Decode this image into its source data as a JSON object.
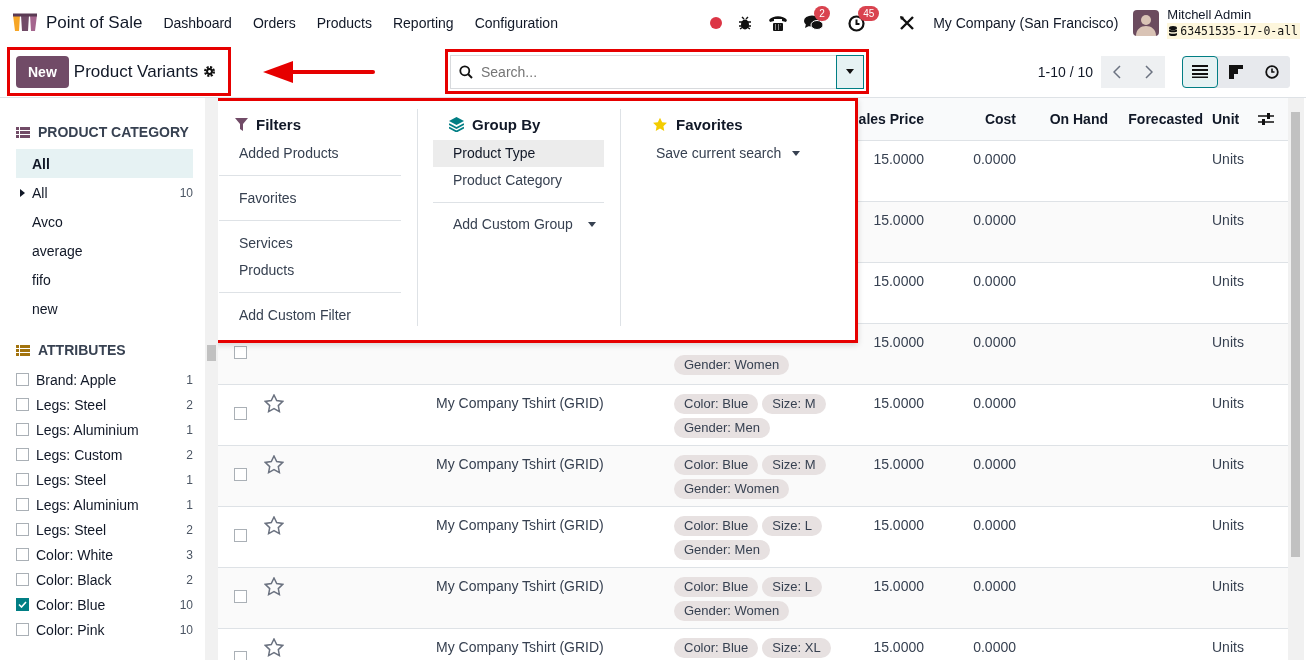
{
  "app": {
    "name": "Point of Sale",
    "menu": [
      "Dashboard",
      "Orders",
      "Products",
      "Reporting",
      "Configuration"
    ]
  },
  "systray": {
    "chat_badge": "2",
    "activity_badge": "45",
    "company": "My Company (San Francisco)",
    "user": "Mitchell Admin",
    "database": "63451535-17-0-all"
  },
  "control_panel": {
    "new_button": "New",
    "title": "Product Variants",
    "search": {
      "placeholder": "Search..."
    },
    "pager": "1-10 / 10",
    "views": [
      {
        "kind": "list",
        "selected": true
      },
      {
        "kind": "kanban",
        "selected": false
      },
      {
        "kind": "activity",
        "selected": false
      }
    ]
  },
  "search_panel": {
    "sections": [
      {
        "kind": "category",
        "title": "PRODUCT CATEGORY",
        "items": [
          {
            "label": "All",
            "selected": true,
            "has_children": false
          },
          {
            "label": "All",
            "selected": false,
            "has_children": true,
            "count": "10"
          },
          {
            "label": "Avco",
            "selected": false,
            "has_children": false
          },
          {
            "label": "average",
            "selected": false,
            "has_children": false
          },
          {
            "label": "fifo",
            "selected": false,
            "has_children": false
          },
          {
            "label": "new",
            "selected": false,
            "has_children": false
          }
        ]
      },
      {
        "kind": "filter",
        "title": "ATTRIBUTES",
        "items": [
          {
            "label": "Brand: Apple",
            "count": "1",
            "checked": false
          },
          {
            "label": "Legs: Steel",
            "count": "2",
            "checked": false
          },
          {
            "label": "Legs: Aluminium",
            "count": "1",
            "checked": false
          },
          {
            "label": "Legs: Custom",
            "count": "2",
            "checked": false
          },
          {
            "label": "Legs: Steel",
            "count": "1",
            "checked": false
          },
          {
            "label": "Legs: Aluminium",
            "count": "1",
            "checked": false
          },
          {
            "label": "Legs: Steel",
            "count": "2",
            "checked": false
          },
          {
            "label": "Color: White",
            "count": "3",
            "checked": false
          },
          {
            "label": "Color: Black",
            "count": "2",
            "checked": false
          },
          {
            "label": "Color: Blue",
            "count": "10",
            "checked": true
          },
          {
            "label": "Color: Pink",
            "count": "10",
            "checked": false
          }
        ]
      }
    ]
  },
  "search_options": {
    "filters": {
      "title": "Filters",
      "groups": [
        {
          "items": [
            "Added Products"
          ]
        },
        {
          "items": [
            "Favorites"
          ]
        },
        {
          "items": [
            "Services",
            "Products"
          ]
        },
        {
          "items": [
            "Add Custom Filter"
          ]
        }
      ]
    },
    "group_by": {
      "title": "Group By",
      "items": [
        {
          "label": "Product Type",
          "selected": true
        },
        {
          "label": "Product Category",
          "selected": false
        }
      ],
      "custom_select": "Add Custom Group"
    },
    "favorites": {
      "title": "Favorites",
      "save_select": "Save current search"
    }
  },
  "table": {
    "header": {
      "sales_price": "ales Price",
      "cost": "Cost",
      "on_hand": "On Hand",
      "forecasted": "Forecasted",
      "unit": "Unit"
    },
    "rows": [
      {
        "sales_price": "15.0000",
        "cost": "0.0000",
        "unit": "Units"
      },
      {
        "sales_price": "15.0000",
        "cost": "0.0000",
        "unit": "Units"
      },
      {
        "sales_price": "15.0000",
        "cost": "0.0000",
        "unit": "Units"
      },
      {
        "checked": false,
        "tags": [
          "Gender: Women"
        ],
        "sales_price": "15.0000",
        "cost": "0.0000",
        "unit": "Units"
      },
      {
        "checked": false,
        "starred": false,
        "name": "My Company Tshirt (GRID)",
        "tags": [
          "Color: Blue",
          "Size: M",
          "Gender: Men"
        ],
        "sales_price": "15.0000",
        "cost": "0.0000",
        "unit": "Units"
      },
      {
        "checked": false,
        "starred": false,
        "name": "My Company Tshirt (GRID)",
        "tags": [
          "Color: Blue",
          "Size: M",
          "Gender: Women"
        ],
        "sales_price": "15.0000",
        "cost": "0.0000",
        "unit": "Units"
      },
      {
        "checked": false,
        "starred": false,
        "name": "My Company Tshirt (GRID)",
        "tags": [
          "Color: Blue",
          "Size: L",
          "Gender: Men"
        ],
        "sales_price": "15.0000",
        "cost": "0.0000",
        "unit": "Units"
      },
      {
        "checked": false,
        "starred": false,
        "name": "My Company Tshirt (GRID)",
        "tags": [
          "Color: Blue",
          "Size: L",
          "Gender: Women"
        ],
        "sales_price": "15.0000",
        "cost": "0.0000",
        "unit": "Units"
      },
      {
        "checked": false,
        "starred": false,
        "name": "My Company Tshirt (GRID)",
        "tags": [
          "Color: Blue",
          "Size: XL"
        ],
        "sales_price": "15.0000",
        "cost": "0.0000",
        "unit": "Units"
      }
    ]
  }
}
